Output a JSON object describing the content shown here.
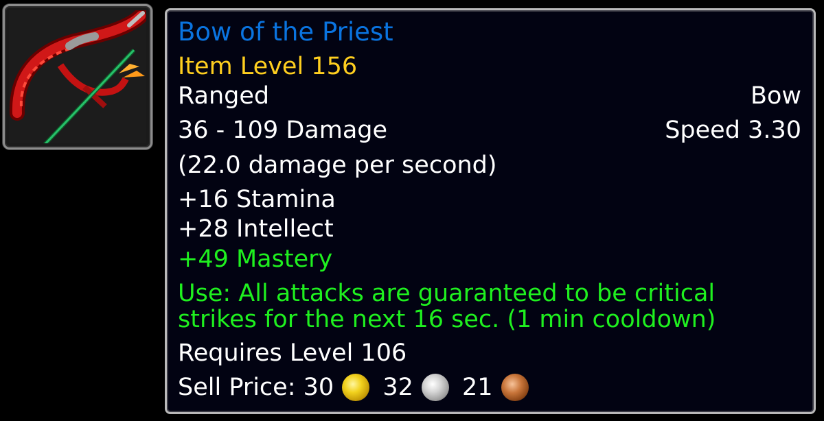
{
  "item": {
    "icon": "bow-icon",
    "name": "Bow of the Priest",
    "item_level": "Item Level 156",
    "slot": "Ranged",
    "type": "Bow",
    "damage": "36 - 109 Damage",
    "speed": "Speed 3.30",
    "dps": "(22.0 damage per second)",
    "stats": [
      "+16 Stamina",
      "+28 Intellect"
    ],
    "bonus_stat": "+49 Mastery",
    "use_effect": [
      "Use: All attacks are guaranteed to be critical",
      "strikes for the next 16 sec. (1 min cooldown)"
    ],
    "requires_level": "Requires Level 106",
    "sell_price": {
      "label": "Sell Price:",
      "gold": "30",
      "silver": "32",
      "copper": "21"
    }
  },
  "colors": {
    "name_rarity_blue": "#0a74e0",
    "item_level_yellow": "#ffcf1f",
    "green_text": "#1ff01f",
    "white_text": "#ffffff",
    "tooltip_background": "#020312"
  }
}
